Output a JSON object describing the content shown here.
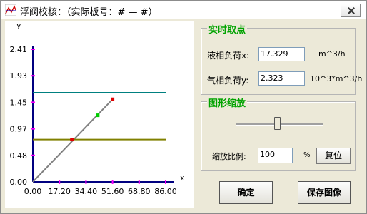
{
  "window": {
    "title": "浮阀校核：（实际板号：# — #）",
    "close_label": ""
  },
  "chart_data": {
    "type": "line",
    "xlabel": "x",
    "ylabel": "y",
    "x_ticks": [
      "0.00",
      "17.20",
      "34.40",
      "51.60",
      "68.80",
      "86.00"
    ],
    "y_ticks": [
      "0.00",
      "0.48",
      "0.97",
      "1.45",
      "1.93",
      "2.41"
    ],
    "xlim": [
      0,
      86
    ],
    "ylim": [
      0,
      2.41
    ],
    "grid": false,
    "series": [
      {
        "kind": "line",
        "color": "#808080",
        "points": [
          [
            0,
            0
          ],
          [
            51.6,
            1.5
          ]
        ]
      },
      {
        "kind": "hline",
        "color": "#008080",
        "y": 1.62
      },
      {
        "kind": "hline",
        "color": "#808000",
        "y": 0.77
      }
    ],
    "markers": [
      {
        "x": 25.3,
        "y": 0.77,
        "color": "#e00000"
      },
      {
        "x": 42.0,
        "y": 1.21,
        "color": "#00cc00"
      },
      {
        "x": 51.6,
        "y": 1.5,
        "color": "#e00000"
      }
    ]
  },
  "realtime": {
    "title": "实时取点",
    "liquid_label": "液相负荷x:",
    "liquid_value": "17.329",
    "liquid_unit": "m^3/h",
    "gas_label": "气相负荷y:",
    "gas_value": "2.323",
    "gas_unit": "10^3*m^3/h"
  },
  "zoom": {
    "title": "图形缩放",
    "slider_value": 50,
    "ratio_label": "缩放比例:",
    "ratio_value": "100",
    "percent": "%",
    "reset_label": "复位"
  },
  "buttons": {
    "ok_label": "确定",
    "save_label": "保存图像"
  }
}
